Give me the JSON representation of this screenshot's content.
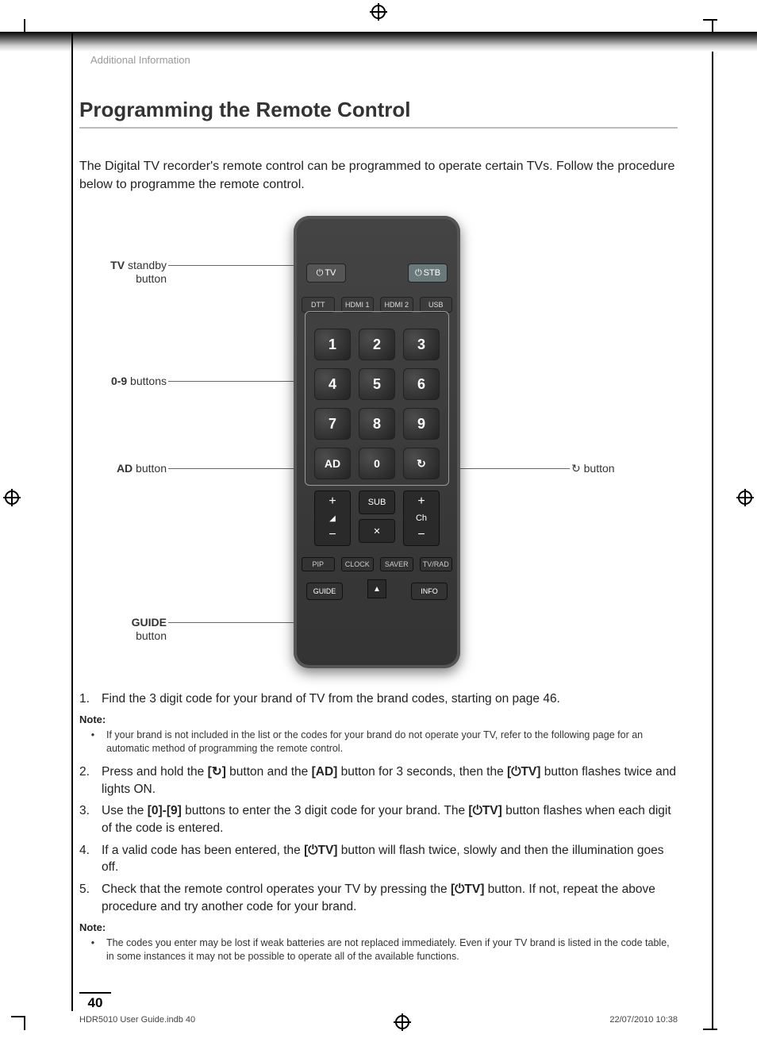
{
  "breadcrumb": "Additional Information",
  "title": "Programming the Remote Control",
  "intro": "The Digital TV recorder's remote control can be programmed to operate certain TVs. Follow the procedure below to programme the remote control.",
  "callouts": {
    "tv_standby": {
      "bold": "TV",
      "rest": " standby button"
    },
    "num_buttons": {
      "bold": "0-9",
      "rest": " buttons"
    },
    "ad_button": {
      "bold": "AD",
      "rest": " button"
    },
    "guide_button": {
      "bold": "GUIDE",
      "rest": " button"
    },
    "refresh_button": {
      "icon": "↻",
      "rest": " button"
    }
  },
  "remote": {
    "top": {
      "tv": "TV",
      "stb": "STB"
    },
    "source_row": [
      "DTT",
      "HDMI 1",
      "HDMI 2",
      "USB"
    ],
    "numpad": [
      [
        "1",
        "2",
        "3"
      ],
      [
        "4",
        "5",
        "6"
      ],
      [
        "7",
        "8",
        "9"
      ]
    ],
    "bottom_row": {
      "ad": "AD",
      "zero": "0",
      "refresh": "↻"
    },
    "middle": {
      "vol_up": "+",
      "vol_down": "−",
      "vol_icon": "◢",
      "sub": "SUB",
      "mute": "✕",
      "ch_label": "Ch",
      "ch_up": "+",
      "ch_down": "−"
    },
    "tiny_row": [
      "PIP",
      "CLOCK",
      "SAVER",
      "TV/RAD"
    ],
    "guide": "GUIDE",
    "info": "INFO",
    "up": "▲"
  },
  "steps": {
    "s1_num": "1.",
    "s1": "Find the 3 digit code for your brand of TV from the brand codes, starting on page 46.",
    "note1_head": "Note:",
    "note1": "If your brand is not included in the list or the codes for your brand do not operate your TV, refer to the following page for an automatic method of programming the remote control.",
    "s2_num": "2.",
    "s2_a": "Press and hold the ",
    "s2_b": "[↻]",
    "s2_c": " button and the ",
    "s2_d": "[AD]",
    "s2_e": " button for 3 seconds, then the ",
    "s2_f": "[⏻TV]",
    "s2_g": " button flashes twice and lights ON.",
    "s3_num": "3.",
    "s3_a": "Use the ",
    "s3_b": "[0]-[9]",
    "s3_c": " buttons to enter the 3 digit code for your brand. The ",
    "s3_d": "[⏻TV]",
    "s3_e": " button flashes when each digit of the code is entered.",
    "s4_num": "4.",
    "s4_a": "If a valid code has been entered, the ",
    "s4_b": "[⏻TV]",
    "s4_c": " button will flash twice, slowly and then the illumination goes off.",
    "s5_num": "5.",
    "s5_a": "Check that the remote control operates your TV by pressing the ",
    "s5_b": "[⏻TV]",
    "s5_c": " button. If not, repeat the above procedure and try another code for your brand.",
    "note2_head": "Note:",
    "note2": "The codes you enter may be lost if weak batteries are not replaced immediately. Even if your TV brand is listed in the code table, in some instances it may not be possible to operate all of the available functions."
  },
  "page_number": "40",
  "footer": {
    "left": "HDR5010 User Guide.indb   40",
    "right": "22/07/2010   10:38"
  }
}
